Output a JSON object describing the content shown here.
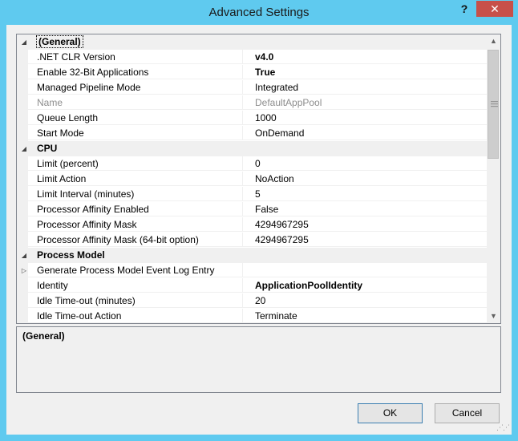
{
  "window": {
    "title": "Advanced Settings",
    "help_label": "?",
    "close_label": "✕"
  },
  "grid": {
    "rows": [
      {
        "type": "category",
        "expander": "◢",
        "name": "(General)",
        "selected": true
      },
      {
        "type": "property",
        "name": ".NET CLR Version",
        "value": "v4.0",
        "bold": true
      },
      {
        "type": "property",
        "name": "Enable 32-Bit Applications",
        "value": "True",
        "bold": true
      },
      {
        "type": "property",
        "name": "Managed Pipeline Mode",
        "value": "Integrated"
      },
      {
        "type": "property",
        "name": "Name",
        "value": "DefaultAppPool",
        "disabled": true
      },
      {
        "type": "property",
        "name": "Queue Length",
        "value": "1000"
      },
      {
        "type": "property",
        "name": "Start Mode",
        "value": "OnDemand"
      },
      {
        "type": "category",
        "expander": "◢",
        "name": "CPU"
      },
      {
        "type": "property",
        "name": "Limit (percent)",
        "value": "0"
      },
      {
        "type": "property",
        "name": "Limit Action",
        "value": "NoAction"
      },
      {
        "type": "property",
        "name": "Limit Interval (minutes)",
        "value": "5"
      },
      {
        "type": "property",
        "name": "Processor Affinity Enabled",
        "value": "False"
      },
      {
        "type": "property",
        "name": "Processor Affinity Mask",
        "value": "4294967295"
      },
      {
        "type": "property",
        "name": "Processor Affinity Mask (64-bit option)",
        "value": "4294967295"
      },
      {
        "type": "category",
        "expander": "◢",
        "name": "Process Model"
      },
      {
        "type": "property",
        "expander": "▷",
        "name": "Generate Process Model Event Log Entry",
        "value": ""
      },
      {
        "type": "property",
        "name": "Identity",
        "value": "ApplicationPoolIdentity",
        "bold": true
      },
      {
        "type": "property",
        "name": "Idle Time-out (minutes)",
        "value": "20"
      },
      {
        "type": "property",
        "name": "Idle Time-out Action",
        "value": "Terminate"
      }
    ]
  },
  "description": {
    "title": "(General)"
  },
  "buttons": {
    "ok_label": "OK",
    "cancel_label": "Cancel"
  }
}
